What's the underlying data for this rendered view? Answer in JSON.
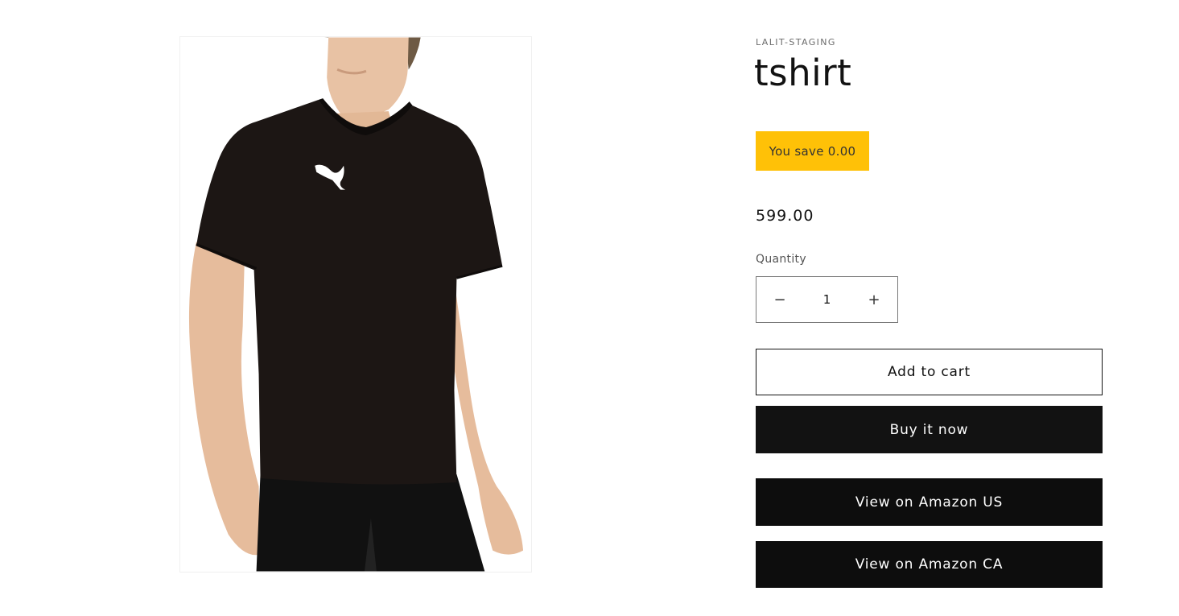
{
  "product": {
    "vendor": "LALIT-STAGING",
    "title": "tshirt",
    "savings_badge": "You save 0.00",
    "price": "599.00",
    "image_alt": "Man wearing black v-neck t-shirt with white puma logo"
  },
  "quantity": {
    "label": "Quantity",
    "value": "1",
    "minus": "−",
    "plus": "+"
  },
  "actions": {
    "add_to_cart": "Add to cart",
    "buy_now": "Buy it now",
    "amazon_us": "View on Amazon US",
    "amazon_ca": "View on Amazon CA"
  },
  "colors": {
    "badge": "#ffc107",
    "dark_button": "#121212",
    "amazon_button": "#0d0d0d"
  }
}
